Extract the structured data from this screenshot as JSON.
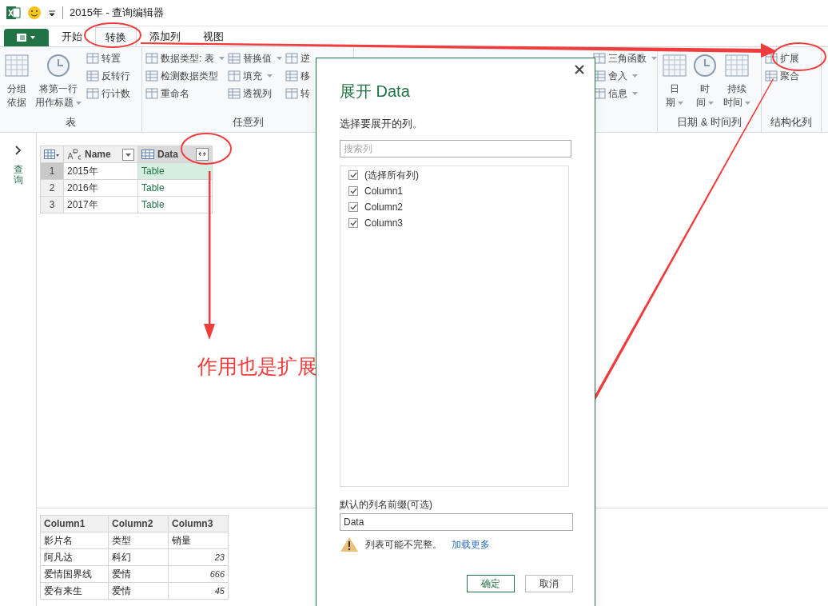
{
  "window": {
    "title": "2015年 - 查询编辑器"
  },
  "tabs": [
    {
      "label": "开始",
      "selected": false
    },
    {
      "label": "转换",
      "selected": true
    },
    {
      "label": "添加列",
      "selected": false
    },
    {
      "label": "视图",
      "selected": false
    }
  ],
  "ribbon": {
    "groups": [
      {
        "label": "表",
        "columns": [
          {
            "kind": "large",
            "lines": [
              "分组",
              "依据"
            ],
            "dropdown": false
          },
          {
            "kind": "large",
            "lines": [
              "将第一行",
              "用作标题"
            ],
            "dropdown": true
          },
          {
            "kind": "stack",
            "items": [
              {
                "label": "转置",
                "dropdown": false
              },
              {
                "label": "反转行",
                "dropdown": false
              },
              {
                "label": "行计数",
                "dropdown": false
              }
            ]
          }
        ]
      },
      {
        "label": "任意列",
        "columns": [
          {
            "kind": "stack",
            "items": [
              {
                "label": "数据类型: 表",
                "dropdown": true
              },
              {
                "label": "检测数据类型",
                "dropdown": false
              },
              {
                "label": "重命名",
                "dropdown": false
              }
            ]
          },
          {
            "kind": "stack",
            "items": [
              {
                "label": "替换值",
                "dropdown": true
              },
              {
                "label": "填充",
                "dropdown": true
              },
              {
                "label": "透视列",
                "dropdown": false
              }
            ]
          },
          {
            "kind": "stack",
            "items": [
              {
                "label": "逆",
                "dropdown": false
              },
              {
                "label": "移",
                "dropdown": false
              },
              {
                "label": "转",
                "dropdown": false
              }
            ]
          }
        ]
      },
      {
        "columns": [
          {
            "kind": "stack",
            "items": [
              {
                "label": "三角函数",
                "dropdown": true
              },
              {
                "label": "舍入",
                "dropdown": true
              },
              {
                "label": "信息",
                "dropdown": true
              }
            ]
          }
        ]
      },
      {
        "label": "日期 & 时间列",
        "columns": [
          {
            "kind": "large",
            "lines": [
              "日",
              "期"
            ],
            "dropdown": true
          },
          {
            "kind": "large",
            "lines": [
              "时",
              "间"
            ],
            "dropdown": true
          },
          {
            "kind": "large",
            "lines": [
              "持续",
              "时间"
            ],
            "dropdown": true
          }
        ]
      },
      {
        "label": "结构化列",
        "columns": [
          {
            "kind": "stack",
            "items": [
              {
                "label": "扩展",
                "dropdown": false
              },
              {
                "label": "聚合",
                "dropdown": false
              }
            ]
          }
        ]
      }
    ]
  },
  "queries_pane": {
    "label": "查询"
  },
  "query_table": {
    "columns": [
      "Name",
      "Data"
    ],
    "rows": [
      {
        "number": "1",
        "name": "2015年",
        "data": "Table",
        "selected": true
      },
      {
        "number": "2",
        "name": "2016年",
        "data": "Table",
        "selected": false
      },
      {
        "number": "3",
        "name": "2017年",
        "data": "Table",
        "selected": false
      }
    ]
  },
  "preview_table": {
    "columns": [
      "Column1",
      "Column2",
      "Column3"
    ],
    "rows": [
      [
        "影片名",
        "类型",
        "销量"
      ],
      [
        "阿凡达",
        "科幻",
        "23"
      ],
      [
        "爱情国界线",
        "爱情",
        "666"
      ],
      [
        "爱有来生",
        "爱情",
        "45"
      ]
    ]
  },
  "annotation": "作用也是扩展",
  "dialog": {
    "title": "展开 Data",
    "subtitle": "选择要展开的列。",
    "search_placeholder": "搜索列",
    "columns": [
      {
        "label": "(选择所有列)",
        "checked": true
      },
      {
        "label": "Column1",
        "checked": true
      },
      {
        "label": "Column2",
        "checked": true
      },
      {
        "label": "Column3",
        "checked": true
      }
    ],
    "prefix_label": "默认的列名前缀(可选)",
    "prefix_value": "Data",
    "warning": "列表可能不完整。",
    "load_more": "加载更多",
    "buttons": [
      {
        "label": "确定",
        "primary": true
      },
      {
        "label": "取消",
        "primary": false
      }
    ]
  }
}
